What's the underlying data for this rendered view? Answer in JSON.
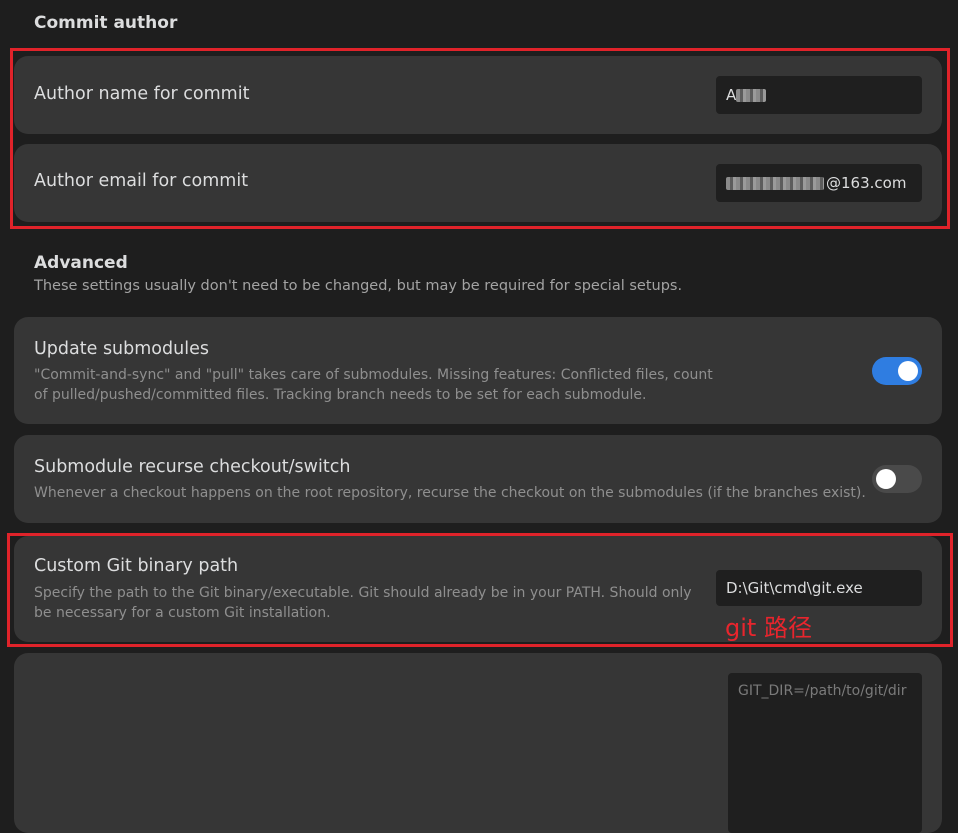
{
  "commit_author": {
    "title": "Commit author",
    "name_setting": {
      "label": "Author name for commit",
      "value_visible": "A"
    },
    "email_setting": {
      "label": "Author email for commit",
      "value_visible": "@163.com"
    }
  },
  "advanced": {
    "title": "Advanced",
    "description": "These settings usually don't need to be changed, but may be required for special setups.",
    "update_submodules": {
      "label": "Update submodules",
      "description": "\"Commit-and-sync\" and \"pull\" takes care of submodules. Missing features: Conflicted files, count of pulled/pushed/committed files. Tracking branch needs to be set for each submodule.",
      "enabled": true
    },
    "submodule_recurse": {
      "label": "Submodule recurse checkout/switch",
      "description": "Whenever a checkout happens on the root repository, recurse the checkout on the submodules (if the branches exist).",
      "enabled": false
    },
    "git_binary_path": {
      "label": "Custom Git binary path",
      "description": "Specify the path to the Git binary/executable. Git should already be in your PATH. Should only be necessary for a custom Git installation.",
      "value": "D:\\Git\\cmd\\git.exe",
      "annotation": "git 路径"
    },
    "env_vars": {
      "placeholder": "GIT_DIR=/path/to/git/dir"
    }
  },
  "colors": {
    "accent": "#2f7de1",
    "highlight_border": "#e0232a",
    "card_background": "#363636",
    "page_background": "#1e1e1e"
  }
}
